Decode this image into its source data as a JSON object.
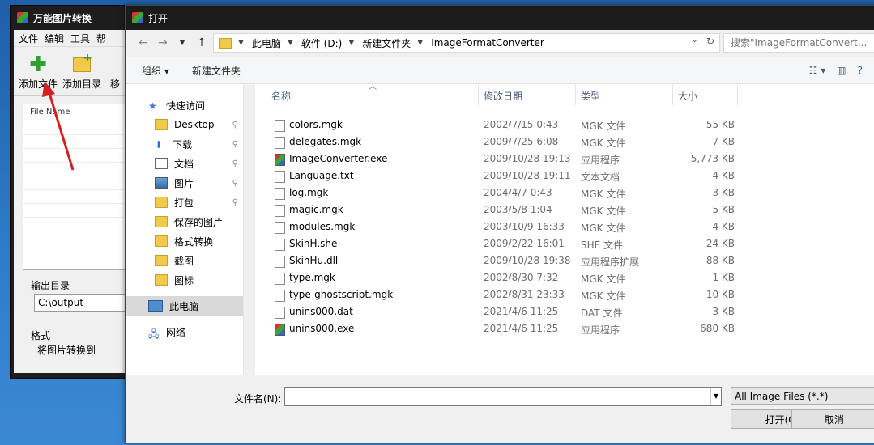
{
  "bg_app": {
    "title": "万能图片转换",
    "menu": [
      "文件",
      "编辑",
      "工具",
      "帮"
    ],
    "toolbar": {
      "add_file": "添加文件",
      "add_dir": "添加目录",
      "more": "移"
    },
    "list_header": "File Name",
    "output_label": "输出目录",
    "output_value": "C:\\output",
    "format_label": "格式",
    "format_text": "将图片转换到"
  },
  "dialog": {
    "title": "打开",
    "breadcrumb": [
      "此电脑",
      "软件 (D:)",
      "新建文件夹",
      "ImageFormatConverter"
    ],
    "search_placeholder": "搜索\"ImageFormatConvert...",
    "cmd": {
      "organize": "组织 ▾",
      "new_folder": "新建文件夹"
    },
    "nav": [
      {
        "label": "快速访问",
        "icon": "star-icon",
        "pinned": false
      },
      {
        "label": "Desktop",
        "icon": "folder-icon",
        "pinned": true
      },
      {
        "label": "下载",
        "icon": "download-icon",
        "pinned": true
      },
      {
        "label": "文档",
        "icon": "document-icon",
        "pinned": true
      },
      {
        "label": "图片",
        "icon": "picture-icon",
        "pinned": true
      },
      {
        "label": "打包",
        "icon": "folder-icon",
        "pinned": true
      },
      {
        "label": "保存的图片",
        "icon": "folder-icon",
        "pinned": false
      },
      {
        "label": "格式转换",
        "icon": "folder-icon",
        "pinned": false
      },
      {
        "label": "截图",
        "icon": "folder-icon",
        "pinned": false
      },
      {
        "label": "图标",
        "icon": "folder-icon",
        "pinned": false
      },
      {
        "label": "此电脑",
        "icon": "computer-icon",
        "pinned": false,
        "selected": true
      },
      {
        "label": "网络",
        "icon": "network-icon",
        "pinned": false
      }
    ],
    "columns": [
      "名称",
      "修改日期",
      "类型",
      "大小"
    ],
    "files": [
      {
        "name": "colors.mgk",
        "date": "2002/7/15 0:43",
        "type": "MGK 文件",
        "size": "55 KB",
        "icon": "file-icon"
      },
      {
        "name": "delegates.mgk",
        "date": "2009/7/25 6:08",
        "type": "MGK 文件",
        "size": "7 KB",
        "icon": "file-icon"
      },
      {
        "name": "ImageConverter.exe",
        "date": "2009/10/28 19:13",
        "type": "应用程序",
        "size": "5,773 KB",
        "icon": "exe-icon"
      },
      {
        "name": "Language.txt",
        "date": "2009/10/28 19:11",
        "type": "文本文档",
        "size": "4 KB",
        "icon": "file-icon"
      },
      {
        "name": "log.mgk",
        "date": "2004/4/7 0:43",
        "type": "MGK 文件",
        "size": "3 KB",
        "icon": "file-icon"
      },
      {
        "name": "magic.mgk",
        "date": "2003/5/8 1:04",
        "type": "MGK 文件",
        "size": "5 KB",
        "icon": "file-icon"
      },
      {
        "name": "modules.mgk",
        "date": "2003/10/9 16:33",
        "type": "MGK 文件",
        "size": "4 KB",
        "icon": "file-icon"
      },
      {
        "name": "SkinH.she",
        "date": "2009/2/22 16:01",
        "type": "SHE 文件",
        "size": "24 KB",
        "icon": "file-icon"
      },
      {
        "name": "SkinHu.dll",
        "date": "2009/10/28 19:38",
        "type": "应用程序扩展",
        "size": "88 KB",
        "icon": "file-icon"
      },
      {
        "name": "type.mgk",
        "date": "2002/8/30 7:32",
        "type": "MGK 文件",
        "size": "1 KB",
        "icon": "file-icon"
      },
      {
        "name": "type-ghostscript.mgk",
        "date": "2002/8/31 23:33",
        "type": "MGK 文件",
        "size": "10 KB",
        "icon": "file-icon"
      },
      {
        "name": "unins000.dat",
        "date": "2021/4/6 11:25",
        "type": "DAT 文件",
        "size": "3 KB",
        "icon": "file-icon"
      },
      {
        "name": "unins000.exe",
        "date": "2021/4/6 11:25",
        "type": "应用程序",
        "size": "680 KB",
        "icon": "exe-icon"
      }
    ],
    "filename_label": "文件名(N):",
    "filetype_value": "All Image Files (*.*)",
    "open_button": "打开(O)",
    "cancel_button": "取消"
  }
}
